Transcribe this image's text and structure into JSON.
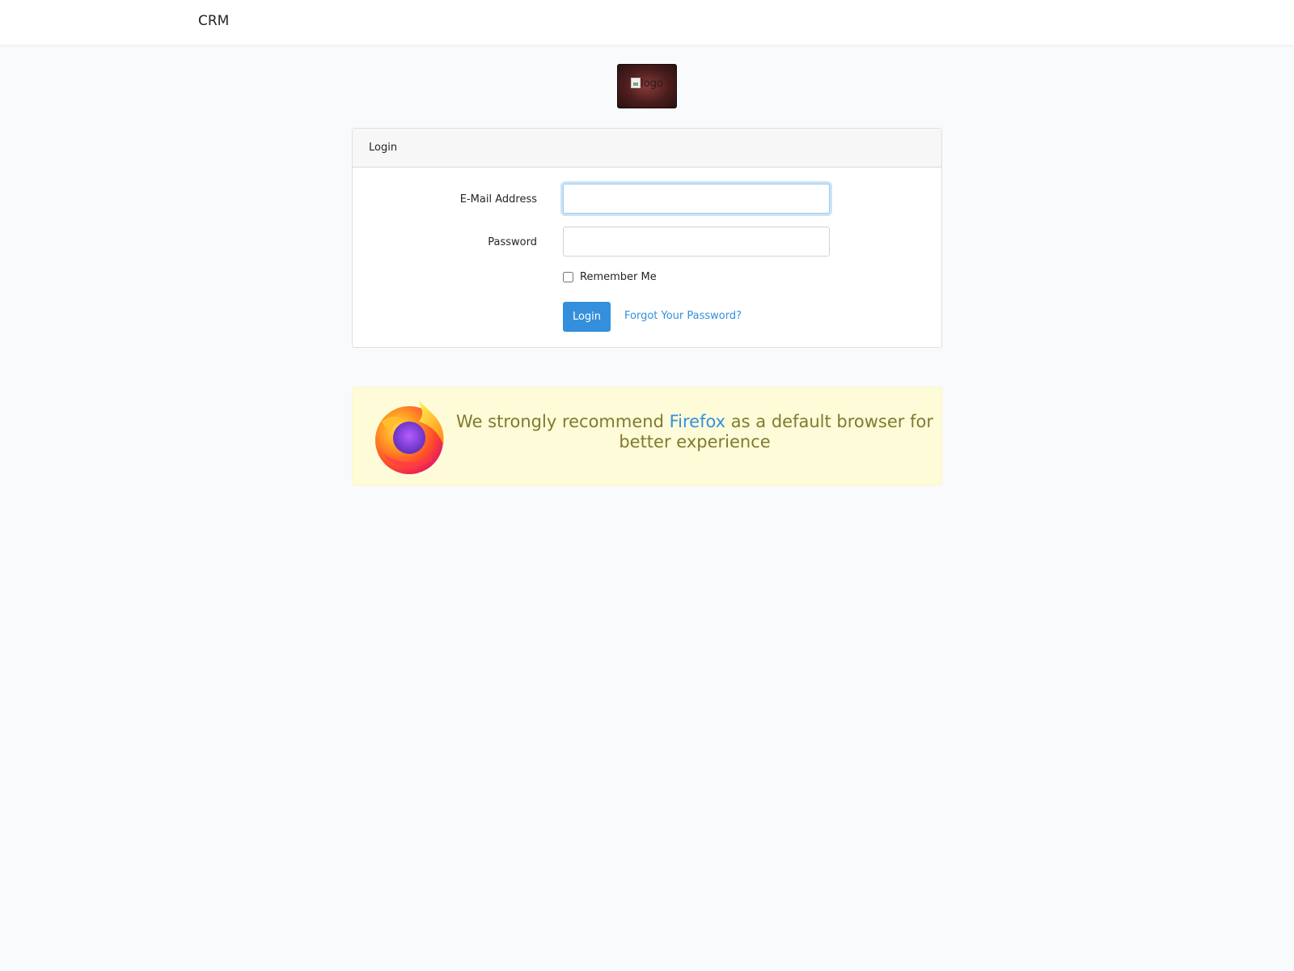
{
  "navbar": {
    "brand": "CRM"
  },
  "logo": {
    "alt": "logo"
  },
  "login_card": {
    "header": "Login",
    "email_label": "E-Mail Address",
    "email_value": "",
    "password_label": "Password",
    "password_value": "",
    "remember_label": "Remember Me",
    "remember_checked": false,
    "submit_label": "Login",
    "forgot_link": "Forgot Your Password?"
  },
  "browser_notice": {
    "text_before": "We strongly recommend ",
    "link_text": "Firefox",
    "text_after": " as a default browser for better experience"
  },
  "colors": {
    "primary": "#3490dc",
    "page_background": "#f8fafc",
    "notice_background": "#fefbd8",
    "notice_text": "#807a2c"
  }
}
